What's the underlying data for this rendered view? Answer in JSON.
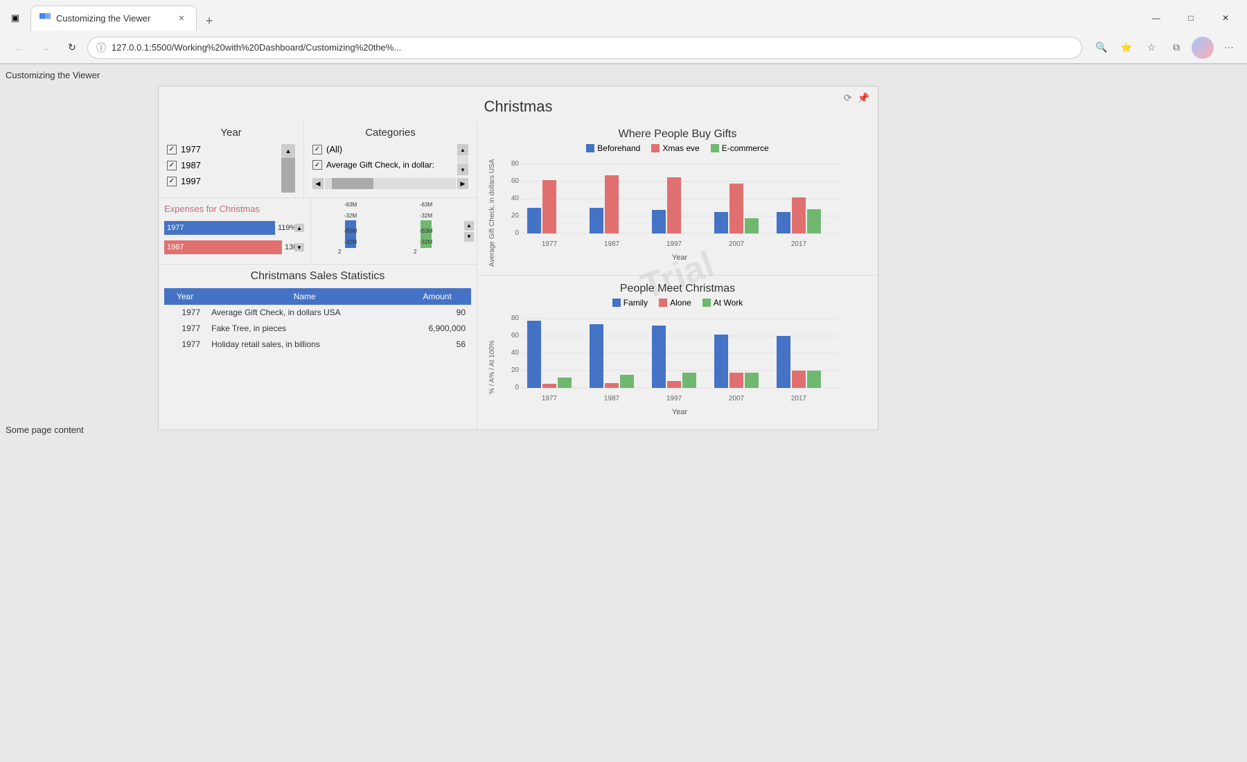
{
  "browser": {
    "tab_title": "Customizing the Viewer",
    "url": "127.0.0.1:5500/Working%20with%20Dashboard/Customizing%20the%...",
    "url_protocol": "127.0.0.1",
    "url_full": "127.0.0.1:5500/Working%20with%20Dashboard/Customizing%20the%..."
  },
  "page": {
    "title": "Customizing the Viewer",
    "some_content": "Some page content"
  },
  "dashboard": {
    "title": "Christmas",
    "year_filter": {
      "title": "Year",
      "items": [
        "1977",
        "1987",
        "1997"
      ]
    },
    "categories_filter": {
      "title": "Categories",
      "items": [
        "(All)",
        "Average Gift Check, in dollar:"
      ]
    },
    "expenses": {
      "title": "Expenses for Christmas",
      "bars": [
        {
          "year": "1977",
          "value": 119,
          "color": "#4472c4"
        },
        {
          "year": "1987",
          "value": 130,
          "color": "#e07070"
        }
      ]
    },
    "sales_table": {
      "title": "Christmans Sales Statistics",
      "columns": [
        "Year",
        "Name",
        "Amount"
      ],
      "rows": [
        {
          "year": "1977",
          "name": "Average Gift Check, in dollars USA",
          "amount": "90"
        },
        {
          "year": "1977",
          "name": "Fake Tree, in pieces",
          "amount": "6,900,000"
        },
        {
          "year": "1977",
          "name": "Holiday retail sales, in billions",
          "amount": "56"
        }
      ]
    },
    "chart1": {
      "title": "Where People Buy Gifts",
      "legend": [
        {
          "label": "Beforehand",
          "color": "#4472c4"
        },
        {
          "label": "Xmas eve",
          "color": "#e07070"
        },
        {
          "label": "E-commerce",
          "color": "#70b870"
        }
      ],
      "x_label": "Year",
      "y_label": "Average Gift Check, in dollars USA",
      "years": [
        "1977",
        "1987",
        "1997",
        "2007",
        "2017"
      ],
      "series": {
        "beforehand": [
          30,
          30,
          28,
          26,
          25
        ],
        "xmas_eve": [
          62,
          68,
          65,
          58,
          42
        ],
        "ecommerce": [
          0,
          0,
          0,
          18,
          28
        ]
      },
      "y_max": 80
    },
    "chart2": {
      "title": "People Meet Christmas",
      "legend": [
        {
          "label": "Family",
          "color": "#4472c4"
        },
        {
          "label": "Alone",
          "color": "#e07070"
        },
        {
          "label": "At Work",
          "color": "#70b870"
        }
      ],
      "x_label": "Year",
      "y_label": "% / A% / At 100%",
      "years": [
        "1977",
        "1987",
        "1997",
        "2007",
        "2017"
      ],
      "series": {
        "family": [
          78,
          74,
          72,
          62,
          60
        ],
        "alone": [
          5,
          6,
          8,
          18,
          20
        ],
        "at_work": [
          12,
          15,
          18,
          18,
          20
        ]
      },
      "y_max": 80
    },
    "watermark": "Trial"
  },
  "icons": {
    "sidebar_toggle": "▣",
    "back": "←",
    "forward": "→",
    "refresh": "↻",
    "info": "ⓘ",
    "zoom": "🔍",
    "star_badge": "⭐",
    "favorites": "☆",
    "collections": "⧉",
    "profile": "👤",
    "menu": "⋯",
    "minimize": "—",
    "maximize": "□",
    "close": "✕",
    "new_tab": "+",
    "tab_close": "✕",
    "chart_icon1": "⟳",
    "chart_icon2": "📌",
    "scroll_up": "▲",
    "scroll_down": "▼",
    "scroll_left": "◀",
    "scroll_right": "▶",
    "checkbox_checked": "✓"
  }
}
